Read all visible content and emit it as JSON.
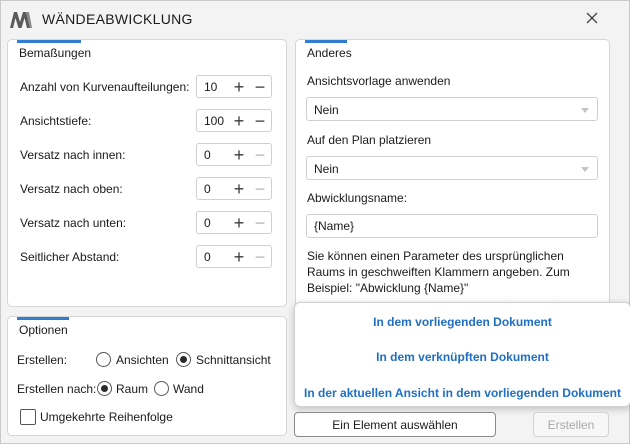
{
  "window": {
    "title": "WÄNDEABWICKLUNG"
  },
  "icons": {
    "logo": "logo-icon",
    "close": "close-icon"
  },
  "bemassungen": {
    "title": "Bemaßungen",
    "rows": [
      {
        "label": "Anzahl von Kurvenaufteilungen:",
        "value": "10",
        "minus_enabled": true
      },
      {
        "label": "Ansichtstiefe:",
        "value": "100",
        "minus_enabled": true
      },
      {
        "label": "Versatz nach innen:",
        "value": "0",
        "minus_enabled": false
      },
      {
        "label": "Versatz nach oben:",
        "value": "0",
        "minus_enabled": false
      },
      {
        "label": "Versatz nach unten:",
        "value": "0",
        "minus_enabled": false
      },
      {
        "label": "Seitlicher Abstand:",
        "value": "0",
        "minus_enabled": false
      }
    ]
  },
  "optionen": {
    "title": "Optionen",
    "erstellen_label": "Erstellen:",
    "erstellen_options": [
      "Ansichten",
      "Schnittansicht"
    ],
    "erstellen_selected": "Schnittansicht",
    "erstellen_nach_label": "Erstellen nach:",
    "erstellen_nach_options": [
      "Raum",
      "Wand"
    ],
    "erstellen_nach_selected": "Raum",
    "reverse_label": "Umgekehrte Reihenfolge",
    "reverse_checked": false
  },
  "anderes": {
    "title": "Anderes",
    "view_template_label": "Ansichtsvorlage anwenden",
    "view_template_value": "Nein",
    "place_on_sheet_label": "Auf den Plan platzieren",
    "place_on_sheet_value": "Nein",
    "name_label": "Abwicklungsname:",
    "name_value": "{Name}",
    "hint": "Sie können einen Parameter des ursprünglichen Raums in geschweiften Klammern angeben. Zum Beispiel: \"Abwicklung {Name}\""
  },
  "popup_menu": {
    "items": [
      "In dem vorliegenden Dokument",
      "In dem verknüpften Dokument",
      "In der aktuellen Ansicht in dem vorliegenden Dokument"
    ]
  },
  "buttons": {
    "select_element": "Ein Element auswählen",
    "create": "Erstellen"
  },
  "colors": {
    "accent": "#2f7dd1",
    "link": "#1f6fc5"
  }
}
